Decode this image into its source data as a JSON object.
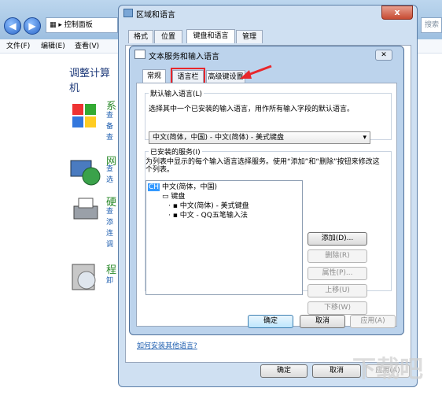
{
  "control_panel": {
    "address": "控制面板",
    "search_placeholder": "搜索",
    "menu": [
      "文件(F)",
      "编辑(E)",
      "查看(V)"
    ],
    "heading": "调整计算机",
    "categories": [
      {
        "title": "系",
        "links": [
          "查",
          "备",
          "查"
        ]
      },
      {
        "title": "网",
        "links": [
          "查",
          "选"
        ]
      },
      {
        "title": "硬",
        "links": [
          "查",
          "添",
          "连",
          "调"
        ]
      },
      {
        "title": "程",
        "links": [
          "卸"
        ]
      }
    ]
  },
  "outer_dialog": {
    "title": "区域和语言",
    "close": "x",
    "tabs": [
      "格式",
      "位置",
      "键盘和语言",
      "管理"
    ],
    "active_tab": 2,
    "link": "如何安装其他语言?",
    "buttons": {
      "ok": "确定",
      "cancel": "取消",
      "apply": "应用(A)"
    }
  },
  "inner_dialog": {
    "title": "文本服务和输入语言",
    "close": "✕",
    "tabs": [
      "常规",
      "语言栏",
      "高级键设置"
    ],
    "active_tab": 0,
    "highlighted_tab": 1,
    "default_lang": {
      "legend": "默认输入语言(L)",
      "desc": "选择其中一个已安装的输入语言，用作所有输入字段的默认语言。",
      "value": "中文(简体，中国) - 中文(简体) - 美式键盘"
    },
    "installed": {
      "legend": "已安装的服务(I)",
      "desc": "为列表中显示的每个输入语言选择服务。使用“添加”和“删除”按钮来修改这个列表。",
      "tree": {
        "badge": "CH",
        "lang": "中文(简体，中国)",
        "group": "键盘",
        "items": [
          "中文(简体) - 美式键盘",
          "中文 - QQ五笔输入法"
        ]
      },
      "buttons": {
        "add": "添加(D)...",
        "remove": "删除(R)",
        "props": "属性(P)...",
        "up": "上移(U)",
        "down": "下移(W)"
      }
    },
    "buttons": {
      "ok": "确定",
      "cancel": "取消",
      "apply": "应用(A)"
    }
  },
  "watermark": "下载吧",
  "colors": {
    "highlight_box": "#e8262b",
    "selection": "#3399ff"
  }
}
